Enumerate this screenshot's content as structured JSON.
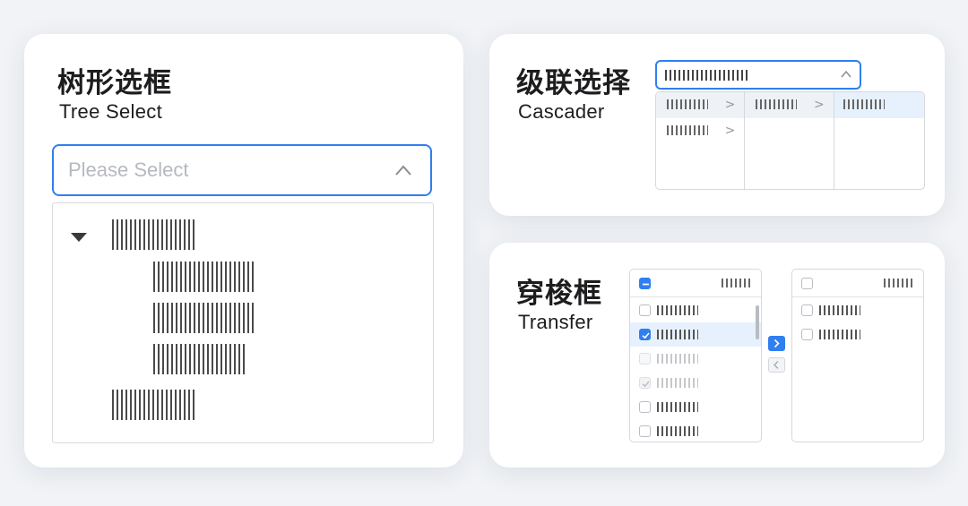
{
  "tree_select": {
    "title_cn": "树形选框",
    "title_en": "Tree Select",
    "placeholder": "Please Select",
    "icons": {
      "expand": "caret-down-icon",
      "toggle": "chevron-up-icon"
    }
  },
  "cascader": {
    "title_cn": "级联选择",
    "title_en": "Cascader",
    "icons": {
      "toggle": "chevron-up-icon",
      "next": "chevron-right-icon"
    },
    "arrow_glyph": ">"
  },
  "transfer": {
    "title_cn": "穿梭框",
    "title_en": "Transfer",
    "icons": {
      "move_right": "chevron-right-icon",
      "move_left": "chevron-left-icon"
    }
  },
  "colors": {
    "accent": "#2f7ff0",
    "background": "#f1f3f6",
    "card": "#ffffff",
    "highlight": "#e7f1fd"
  }
}
